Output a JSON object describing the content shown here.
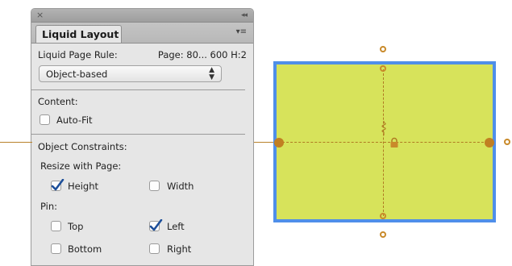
{
  "panel": {
    "close_glyph": "×",
    "collapse_glyph": "◂◂",
    "tab_title": "Liquid Layout",
    "menu_glyph": "▾≡",
    "liquid_page_rule_label": "Liquid Page Rule:",
    "liquid_page_rule_value": "Page: 80... 600 H:2",
    "rule_dropdown": {
      "selected": "Object-based",
      "arrow": "⬍"
    },
    "content_section": {
      "label": "Content:",
      "auto_fit": {
        "label": "Auto-Fit",
        "checked": false
      }
    },
    "object_constraints": {
      "label": "Object Constraints:",
      "resize_with_page_label": "Resize with Page:",
      "height": {
        "label": "Height",
        "checked": true
      },
      "width": {
        "label": "Width",
        "checked": false
      },
      "pin_label": "Pin:",
      "top": {
        "label": "Top",
        "checked": false
      },
      "left": {
        "label": "Left",
        "checked": true
      },
      "bottom": {
        "label": "Bottom",
        "checked": false
      },
      "right": {
        "label": "Right",
        "checked": false
      }
    }
  },
  "canvas": {
    "frame_fill_color": "#d7e35b",
    "frame_border_color": "#4f8fe9",
    "guide_color": "#b9822b",
    "icons": [
      "lock-icon",
      "spring-icon"
    ]
  }
}
